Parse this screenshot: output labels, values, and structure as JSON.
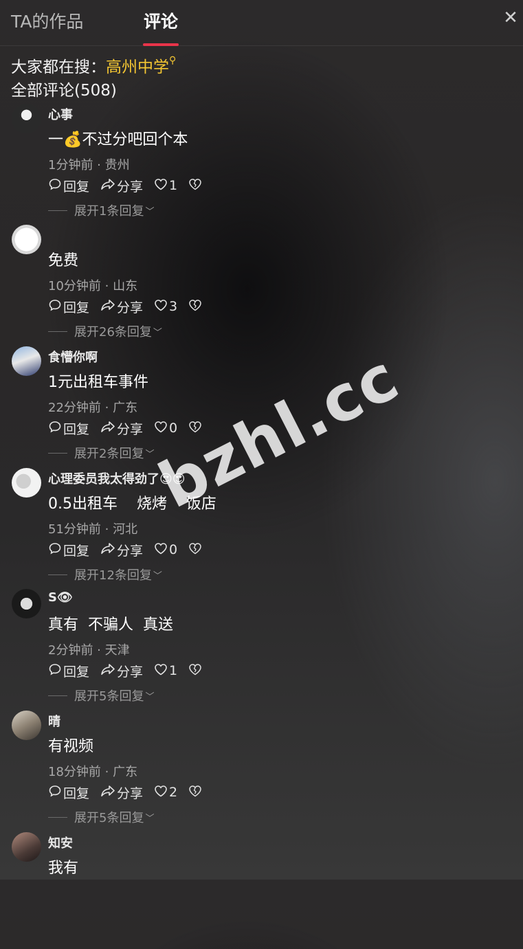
{
  "tabs": {
    "works": "TA的作品",
    "comments": "评论"
  },
  "search": {
    "prefix": "大家都在搜：",
    "term": "高州中学"
  },
  "total": {
    "text": "全部评论(508)"
  },
  "actions": {
    "reply": "回复",
    "share": "分享"
  },
  "comments": [
    {
      "user": "心事",
      "content": "一💰不过分吧回个本",
      "meta": "1分钟前 · 贵州",
      "likes": "1",
      "expand": "展开1条回复"
    },
    {
      "user": "",
      "content": "免费",
      "meta": "10分钟前 · 山东",
      "likes": "3",
      "expand": "展开26条回复"
    },
    {
      "user": "食懵你啊",
      "content": "1元出租车事件",
      "meta": "22分钟前 · 广东",
      "likes": "0",
      "expand": "展开2条回复"
    },
    {
      "user": "心理委员我太得劲了😍😍",
      "content": "0.5出租车    烧烤    饭店",
      "meta": "51分钟前 · 河北",
      "likes": "0",
      "expand": "展开12条回复"
    },
    {
      "user": "S👁",
      "content": "真有  不骗人  真送",
      "meta": "2分钟前 · 天津",
      "likes": "1",
      "expand": "展开5条回复"
    },
    {
      "user": "晴",
      "content": "有视频",
      "meta": "18分钟前 · 广东",
      "likes": "2",
      "expand": "展开5条回复"
    },
    {
      "user": "知安",
      "content": "我有",
      "meta": "",
      "likes": "",
      "expand": ""
    }
  ],
  "watermark": "bzhl.cc",
  "colors": {
    "accent": "#e8344a",
    "search_term": "#f4c632"
  }
}
